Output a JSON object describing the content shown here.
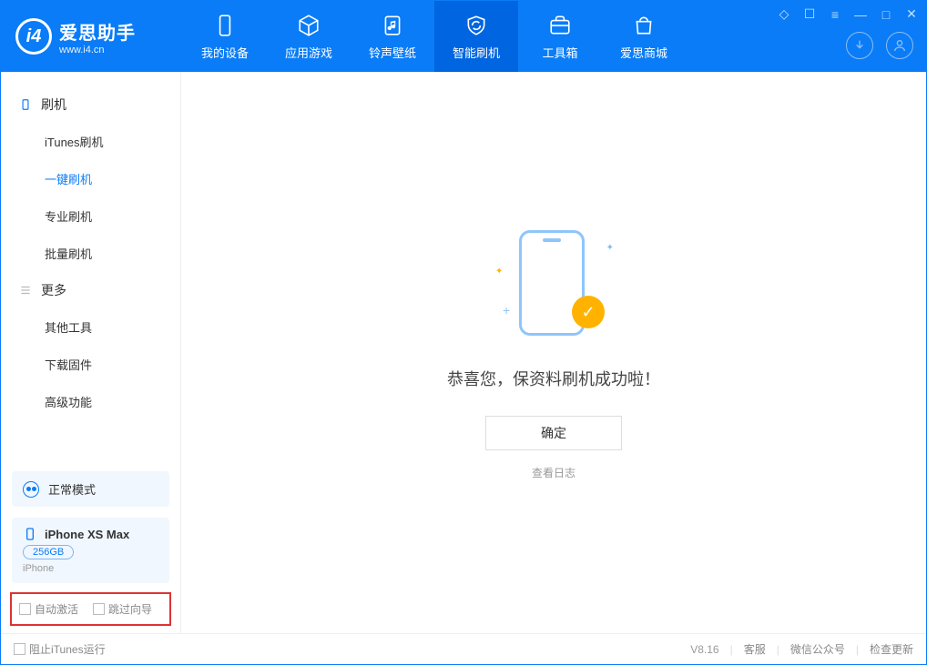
{
  "app": {
    "title": "爱思助手",
    "subtitle": "www.i4.cn"
  },
  "tabs": {
    "device": "我的设备",
    "apps": "应用游戏",
    "ringtone": "铃声壁纸",
    "flash": "智能刷机",
    "toolbox": "工具箱",
    "store": "爱思商城"
  },
  "sidebar": {
    "group1": "刷机",
    "items1": {
      "itunes": "iTunes刷机",
      "oneclick": "一键刷机",
      "pro": "专业刷机",
      "batch": "批量刷机"
    },
    "group2": "更多",
    "items2": {
      "other": "其他工具",
      "firmware": "下载固件",
      "advanced": "高级功能"
    }
  },
  "mode": {
    "label": "正常模式"
  },
  "device": {
    "name": "iPhone XS Max",
    "capacity": "256GB",
    "type": "iPhone"
  },
  "checks": {
    "auto_activate": "自动激活",
    "skip_guide": "跳过向导"
  },
  "main": {
    "success": "恭喜您，保资料刷机成功啦！",
    "ok": "确定",
    "view_log": "查看日志"
  },
  "footer": {
    "block_itunes": "阻止iTunes运行",
    "version": "V8.16",
    "support": "客服",
    "wechat": "微信公众号",
    "update": "检查更新"
  }
}
